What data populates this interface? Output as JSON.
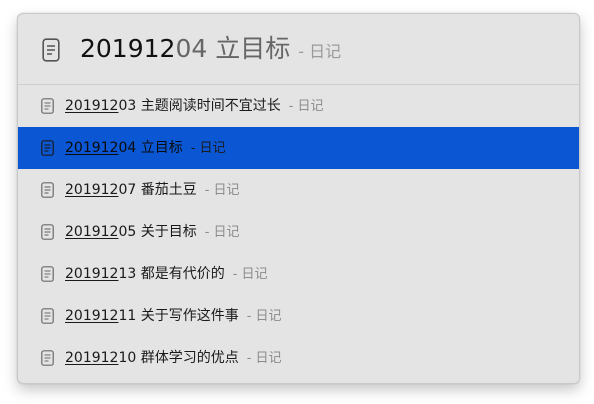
{
  "search": {
    "typed": "201912",
    "completion": "04 立目标",
    "tag": "- 日记"
  },
  "results": [
    {
      "match": "201912",
      "rest": "03 主题阅读时间不宜过长",
      "tag": "- 日记",
      "selected": false
    },
    {
      "match": "201912",
      "rest": "04 立目标",
      "tag": "- 日记",
      "selected": true
    },
    {
      "match": "201912",
      "rest": "07 番茄土豆",
      "tag": "- 日记",
      "selected": false
    },
    {
      "match": "201912",
      "rest": "05 关于目标",
      "tag": "- 日记",
      "selected": false
    },
    {
      "match": "201912",
      "rest": "13 都是有代价的",
      "tag": "- 日记",
      "selected": false
    },
    {
      "match": "201912",
      "rest": "11 关于写作这件事",
      "tag": "- 日记",
      "selected": false
    },
    {
      "match": "201912",
      "rest": "10 群体学习的优点",
      "tag": "- 日记",
      "selected": false
    }
  ],
  "colors": {
    "selection": "#0b56d3",
    "panel": "#e4e4e4"
  },
  "icons": {
    "search": "note-document-icon",
    "result": "note-document-icon"
  }
}
